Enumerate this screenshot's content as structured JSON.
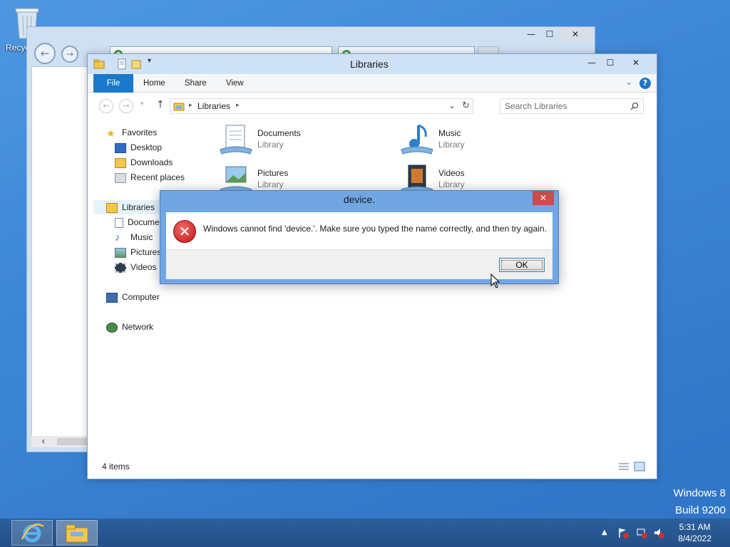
{
  "desktop": {
    "recycle_bin_label": "Recyc",
    "watermark_line1": "Windows 8",
    "watermark_line2": "Build 9200"
  },
  "explorer": {
    "title": "Libraries",
    "ribbon_tabs": [
      "File",
      "Home",
      "Share",
      "View"
    ],
    "address_crumb": "Libraries",
    "search_placeholder": "Search Libraries",
    "nav": {
      "favorites": "Favorites",
      "favorites_items": [
        "Desktop",
        "Downloads",
        "Recent places"
      ],
      "libraries": "Libraries",
      "libraries_items": [
        "Docume",
        "Music",
        "Pictures",
        "Videos"
      ],
      "computer": "Computer",
      "network": "Network"
    },
    "tiles": [
      {
        "name": "Documents",
        "sub": "Library"
      },
      {
        "name": "Music",
        "sub": "Library"
      },
      {
        "name": "Pictures",
        "sub": "Library"
      },
      {
        "name": "Videos",
        "sub": "Library"
      }
    ],
    "status": "4 items"
  },
  "dialog": {
    "title": "device.",
    "message": "Windows cannot find 'device.'. Make sure you typed the name correctly, and then try again.",
    "ok_label": "OK",
    "close_glyph": "✕"
  },
  "taskbar": {
    "time": "5:31 AM",
    "date": "8/4/2022"
  },
  "colors": {
    "accent": "#1979ca",
    "desktop": "#3d86d6",
    "dialog_frame": "#70a6e3",
    "error_red": "#c21212"
  }
}
